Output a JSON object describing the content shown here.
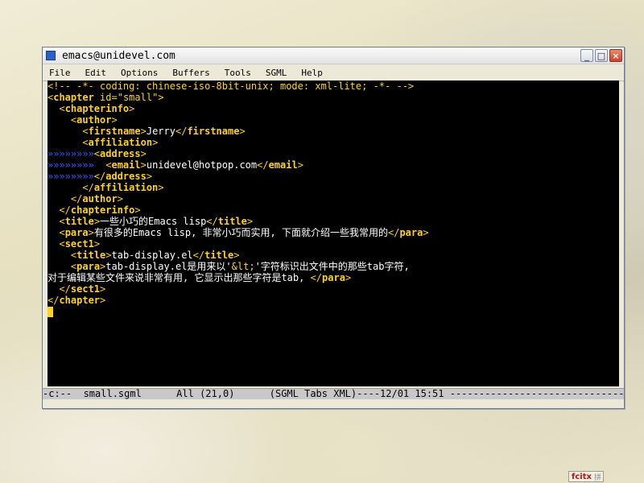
{
  "window": {
    "title": "emacs@unidevel.com",
    "buttons": {
      "minimize": "_",
      "maximize": "□",
      "close": "×"
    }
  },
  "menu": [
    "File",
    "Edit",
    "Options",
    "Buffers",
    "Tools",
    "SGML",
    "Help"
  ],
  "buffer": {
    "lines": [
      [
        [
          "cm",
          "<!-- -*- coding: chinese-iso-8bit-unix; mode: xml-lite; -*- -->"
        ]
      ],
      [
        [
          "br",
          "<"
        ],
        [
          "tg",
          "chapter"
        ],
        [
          "tx",
          " "
        ],
        [
          "at",
          "id"
        ],
        [
          "br",
          "=\"small\">"
        ]
      ],
      [
        [
          "tx",
          "  "
        ],
        [
          "br",
          "<"
        ],
        [
          "tg",
          "chapterinfo"
        ],
        [
          "br",
          ">"
        ]
      ],
      [
        [
          "tx",
          "    "
        ],
        [
          "br",
          "<"
        ],
        [
          "tg",
          "author"
        ],
        [
          "br",
          ">"
        ]
      ],
      [
        [
          "tx",
          "      "
        ],
        [
          "br",
          "<"
        ],
        [
          "tg",
          "firstname"
        ],
        [
          "br",
          ">"
        ],
        [
          "tx",
          "Jerry"
        ],
        [
          "br",
          "</"
        ],
        [
          "tg",
          "firstname"
        ],
        [
          "br",
          ">"
        ]
      ],
      [
        [
          "tx",
          "      "
        ],
        [
          "br",
          "<"
        ],
        [
          "tg",
          "affiliation"
        ],
        [
          "br",
          ">"
        ]
      ],
      [
        [
          "tab",
          "»»»»»»»»"
        ],
        [
          "br",
          "<"
        ],
        [
          "tg",
          "address"
        ],
        [
          "br",
          ">"
        ]
      ],
      [
        [
          "tab",
          "»»»»»»»»"
        ],
        [
          "tx",
          "  "
        ],
        [
          "br",
          "<"
        ],
        [
          "tg",
          "email"
        ],
        [
          "br",
          ">"
        ],
        [
          "tx",
          "unidevel@hotpop.com"
        ],
        [
          "br",
          "</"
        ],
        [
          "tg",
          "email"
        ],
        [
          "br",
          ">"
        ]
      ],
      [
        [
          "tab",
          "»»»»»»»»"
        ],
        [
          "br",
          "</"
        ],
        [
          "tg",
          "address"
        ],
        [
          "br",
          ">"
        ]
      ],
      [
        [
          "tx",
          "      "
        ],
        [
          "br",
          "</"
        ],
        [
          "tg",
          "affiliation"
        ],
        [
          "br",
          ">"
        ]
      ],
      [
        [
          "tx",
          "    "
        ],
        [
          "br",
          "</"
        ],
        [
          "tg",
          "author"
        ],
        [
          "br",
          ">"
        ]
      ],
      [
        [
          "tx",
          "  "
        ],
        [
          "br",
          "</"
        ],
        [
          "tg",
          "chapterinfo"
        ],
        [
          "br",
          ">"
        ]
      ],
      [
        [
          "tx",
          "  "
        ],
        [
          "br",
          "<"
        ],
        [
          "tg",
          "title"
        ],
        [
          "br",
          ">"
        ],
        [
          "tx",
          "一些小巧的Emacs lisp"
        ],
        [
          "br",
          "</"
        ],
        [
          "tg",
          "title"
        ],
        [
          "br",
          ">"
        ]
      ],
      [
        [
          "tx",
          "  "
        ],
        [
          "br",
          "<"
        ],
        [
          "tg",
          "para"
        ],
        [
          "br",
          ">"
        ],
        [
          "tx",
          "有很多的Emacs lisp, 非常小巧而实用, 下面就介绍一些我常用的"
        ],
        [
          "br",
          "</"
        ],
        [
          "tg",
          "para"
        ],
        [
          "br",
          ">"
        ]
      ],
      [
        [
          "tx",
          "  "
        ],
        [
          "br",
          "<"
        ],
        [
          "tg",
          "sect1"
        ],
        [
          "br",
          ">"
        ]
      ],
      [
        [
          "tx",
          "    "
        ],
        [
          "br",
          "<"
        ],
        [
          "tg",
          "title"
        ],
        [
          "br",
          ">"
        ],
        [
          "tx",
          "tab-display.el"
        ],
        [
          "br",
          "</"
        ],
        [
          "tg",
          "title"
        ],
        [
          "br",
          ">"
        ]
      ],
      [
        [
          "tx",
          "    "
        ],
        [
          "br",
          "<"
        ],
        [
          "tg",
          "para"
        ],
        [
          "br",
          ">"
        ],
        [
          "tx",
          "tab-display.el是用来以'"
        ],
        [
          "ent",
          "&lt;"
        ],
        [
          "tx",
          "'字符标识出文件中的那些tab字符,"
        ]
      ],
      [
        [
          "tx",
          "对于编辑某些文件来说非常有用, 它显示出那些字符是tab, "
        ],
        [
          "br",
          "</"
        ],
        [
          "tg",
          "para"
        ],
        [
          "br",
          ">"
        ]
      ],
      [
        [
          "tx",
          "  "
        ],
        [
          "br",
          "</"
        ],
        [
          "tg",
          "sect1"
        ],
        [
          "br",
          ">"
        ]
      ],
      [
        [
          "br",
          "</"
        ],
        [
          "tg",
          "chapter"
        ],
        [
          "br",
          ">"
        ]
      ]
    ]
  },
  "modeline": {
    "text": "-c:--  small.sgml      All (21,0)      (SGML Tabs XML)----12/01 15:51 ---------------------------------------------"
  },
  "tray": {
    "label": "fcitx",
    "im": "拼"
  }
}
